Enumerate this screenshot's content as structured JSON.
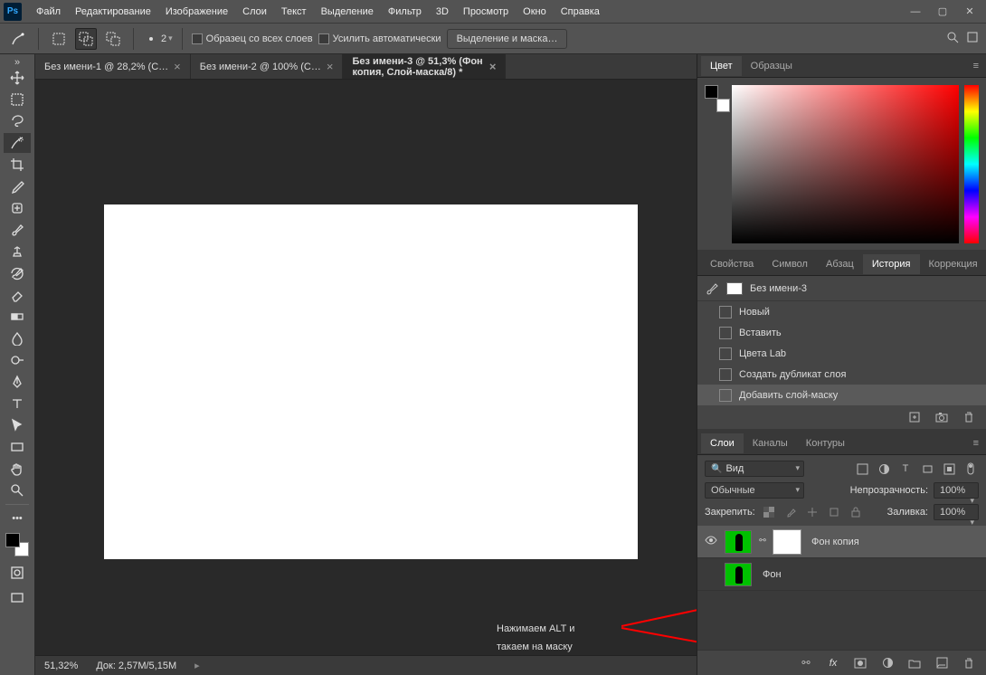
{
  "menu": {
    "items": [
      "Файл",
      "Редактирование",
      "Изображение",
      "Слои",
      "Текст",
      "Выделение",
      "Фильтр",
      "3D",
      "Просмотр",
      "Окно",
      "Справка"
    ]
  },
  "optbar": {
    "brush_size": "2",
    "chk_sample": "Образец со всех слоев",
    "chk_enhance": "Усилить автоматически",
    "btn_select_mask": "Выделение и маска…"
  },
  "tabs": [
    {
      "label": "Без имени-1 @ 28,2% (С…"
    },
    {
      "label": "Без имени-2 @ 100% (С…"
    },
    {
      "label": "Без имени-3 @ 51,3% (Фон копия, Слой-маска/8) *"
    }
  ],
  "status": {
    "zoom": "51,32%",
    "doc": "Док: 2,57M/5,15M"
  },
  "color_panel": {
    "tab_color": "Цвет",
    "tab_swatches": "Образцы"
  },
  "prop_panel": {
    "tabs": [
      "Свойства",
      "Символ",
      "Абзац",
      "История",
      "Коррекция"
    ],
    "active": 3
  },
  "history": {
    "doc_name": "Без имени-3",
    "items": [
      "Новый",
      "Вставить",
      "Цвета Lab",
      "Создать дубликат слоя",
      "Добавить слой-маску"
    ],
    "selected": 4
  },
  "layers_panel": {
    "tabs": [
      "Слои",
      "Каналы",
      "Контуры"
    ],
    "active": 0,
    "kind": "Вид",
    "blend": "Обычные",
    "opacity_label": "Непрозрачность:",
    "opacity": "100%",
    "lock_label": "Закрепить:",
    "fill_label": "Заливка:",
    "fill": "100%",
    "layers": [
      {
        "name": "Фон копия",
        "mask": true,
        "sel": true,
        "vis": true
      },
      {
        "name": "Фон",
        "mask": false,
        "sel": false,
        "vis": false
      }
    ]
  },
  "annot": {
    "line1": "Нажимаем ALT и",
    "line2": "такаем на маску"
  }
}
